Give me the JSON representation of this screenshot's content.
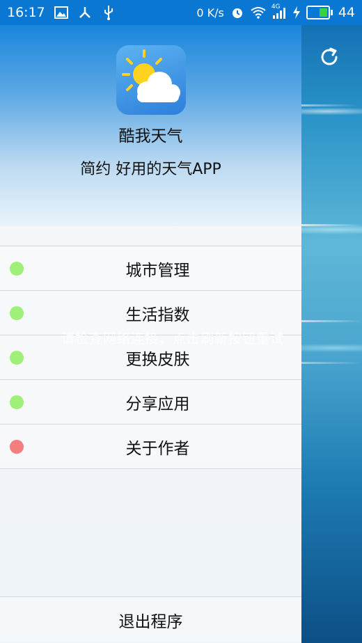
{
  "status_bar": {
    "time": "16:17",
    "net_speed": "0 K/s",
    "signal_type": "4G",
    "battery_level": "44",
    "battery_fraction": 0.44,
    "icons": [
      "image-icon",
      "usb-tether-icon",
      "usb-icon",
      "alarm-icon",
      "wifi-icon",
      "signal-icon",
      "charging-icon",
      "battery-icon"
    ]
  },
  "app": {
    "name": "酷我天气",
    "slogan": "简约 好用的天气APP",
    "icon": "weather-sun-cloud-icon"
  },
  "menu": {
    "items": [
      {
        "label": "城市管理",
        "dot_color": "#9ef07b"
      },
      {
        "label": "生活指数",
        "dot_color": "#9ef07b"
      },
      {
        "label": "更换皮肤",
        "dot_color": "#9ef07b"
      },
      {
        "label": "分享应用",
        "dot_color": "#9ef07b"
      },
      {
        "label": "关于作者",
        "dot_color": "#f47d7d"
      }
    ],
    "exit_label": "退出程序"
  },
  "toast": {
    "text": "请检查网络连接，点击刷新按钮重试"
  },
  "refresh": {
    "icon": "refresh-icon"
  },
  "colors": {
    "status_bar": "#0a78d2",
    "dot_green": "#9ef07b",
    "dot_red": "#f47d7d"
  }
}
